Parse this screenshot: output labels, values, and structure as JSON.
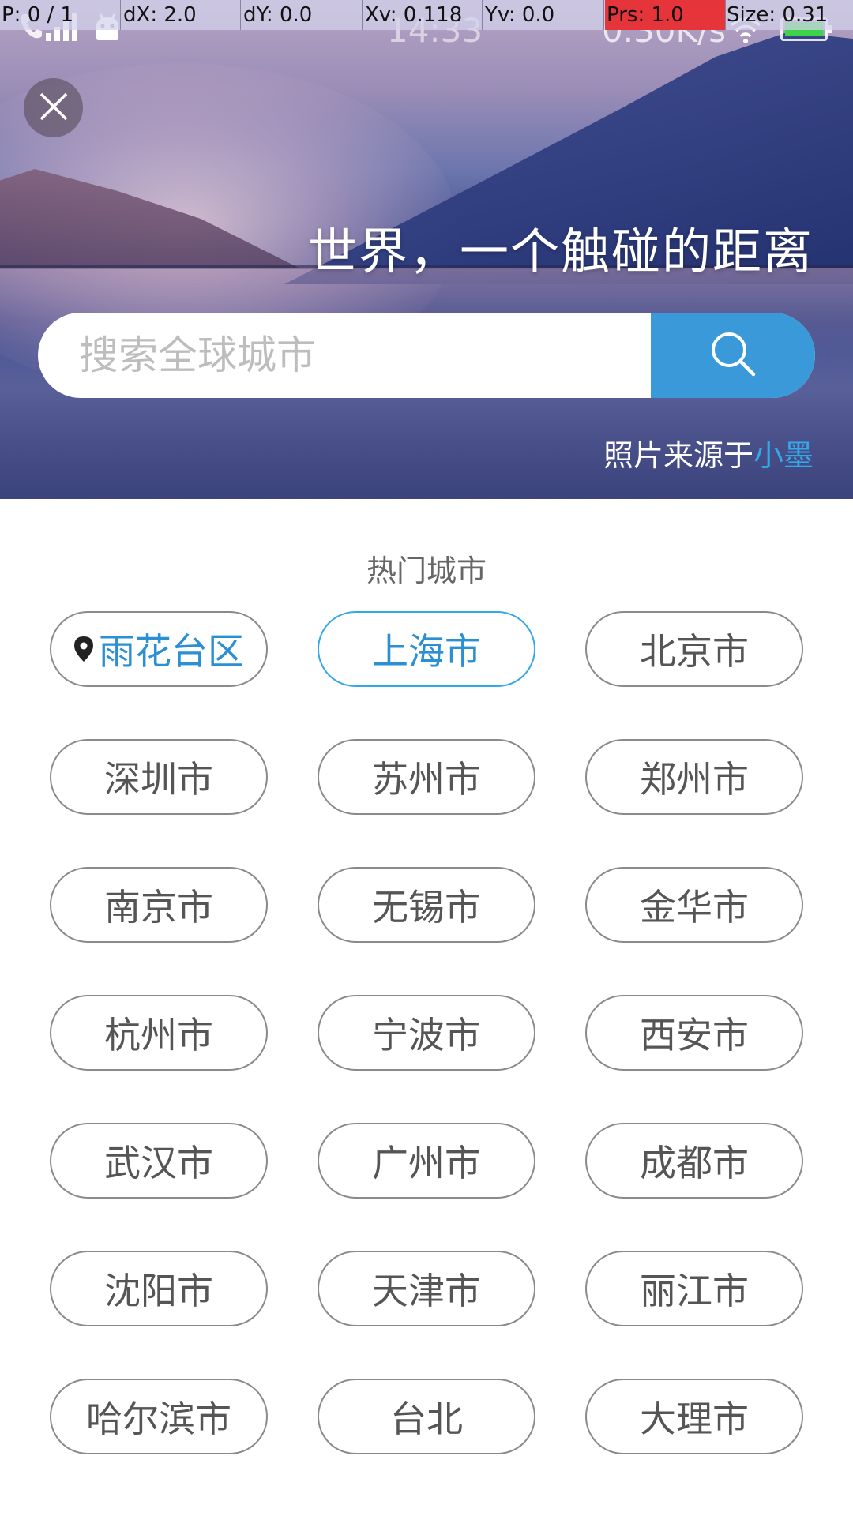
{
  "debug_bar": {
    "p": "P: 0 / 1",
    "dx": "dX: 2.0",
    "dy": "dY: 0.0",
    "xv": "Xv: 0.118",
    "yv": "Yv: 0.0",
    "prs": "Prs: 1.0",
    "size": "Size: 0.31"
  },
  "status_bar": {
    "time": "14:33",
    "network_speed": "0.30K/s"
  },
  "hero": {
    "slogan": "世界，一个触碰的距离",
    "credit_prefix": "照片来源于",
    "credit_author": "小墨"
  },
  "search": {
    "placeholder": "搜索全球城市",
    "value": ""
  },
  "hot_cities": {
    "title": "热门城市",
    "current_location": "雨花台区",
    "cities": [
      "上海市",
      "北京市",
      "深圳市",
      "苏州市",
      "郑州市",
      "南京市",
      "无锡市",
      "金华市",
      "杭州市",
      "宁波市",
      "西安市",
      "武汉市",
      "广州市",
      "成都市",
      "沈阳市",
      "天津市",
      "丽江市",
      "哈尔滨市",
      "台北",
      "大理市"
    ]
  },
  "colors": {
    "accent": "#3a9ad9",
    "link": "#35a8e8",
    "prs_highlight": "#e5343a"
  }
}
